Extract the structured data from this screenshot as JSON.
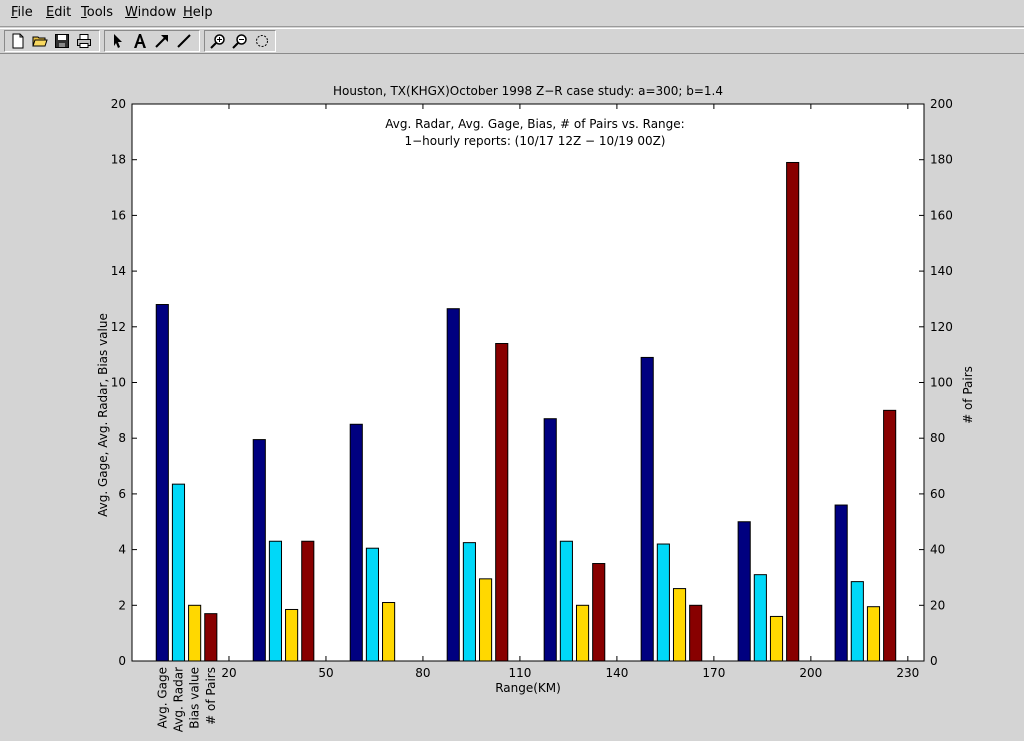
{
  "menu": {
    "items": [
      "File",
      "Edit",
      "Tools",
      "Window",
      "Help"
    ]
  },
  "toolbar": {
    "buttons": [
      "new-file-icon",
      "open-folder-icon",
      "save-icon",
      "print-icon",
      "pointer-icon",
      "text-icon",
      "arrow-icon",
      "line-icon",
      "zoom-in-icon",
      "zoom-out-icon",
      "rotate-icon"
    ]
  },
  "colors": {
    "avg_gage": "#000080",
    "avg_radar": "#00d8f8",
    "bias": "#ffd800",
    "pairs": "#880000"
  },
  "chart_data": {
    "type": "bar",
    "title": "Houston, TX(KHGX)October 1998 Z−R case study: a=300; b=1.4",
    "annotation": [
      "Avg. Radar, Avg. Gage, Bias, # of Pairs vs. Range:",
      "1−hourly reports: (10/17 12Z − 10/19 00Z)"
    ],
    "xlabel": "Range(KM)",
    "ylabel": "Avg. Gage, Avg. Radar, Bias value",
    "ylabel_right": "# of Pairs",
    "x_ticks": [
      20,
      50,
      80,
      110,
      140,
      170,
      200,
      230
    ],
    "xlim": [
      -10,
      235
    ],
    "ylim": [
      0,
      20
    ],
    "ylim_right": [
      0,
      200
    ],
    "y_ticks": [
      0,
      2,
      4,
      6,
      8,
      10,
      12,
      14,
      16,
      18,
      20
    ],
    "y_ticks_right": [
      0,
      20,
      40,
      60,
      80,
      100,
      120,
      140,
      160,
      180,
      200
    ],
    "group_centers": [
      5,
      35,
      65,
      95,
      125,
      155,
      185,
      215
    ],
    "legend_labels": [
      "Avg. Gage",
      "Avg. Radar",
      "Bias value",
      "# of Pairs"
    ],
    "series": [
      {
        "name": "Avg. Gage",
        "axis": "left",
        "values": [
          12.8,
          7.95,
          8.5,
          12.65,
          8.7,
          10.9,
          5.0,
          5.6
        ]
      },
      {
        "name": "Avg. Radar",
        "axis": "left",
        "values": [
          6.35,
          4.3,
          4.05,
          4.25,
          4.3,
          4.2,
          3.1,
          2.85
        ]
      },
      {
        "name": "Bias value",
        "axis": "left",
        "values": [
          2.0,
          1.85,
          2.1,
          2.95,
          2.0,
          2.6,
          1.6,
          1.95
        ]
      },
      {
        "name": "# of Pairs",
        "axis": "right",
        "values": [
          17,
          43,
          0,
          114,
          35,
          20,
          179,
          90
        ]
      }
    ],
    "grid": false,
    "legend": "below-axis"
  }
}
